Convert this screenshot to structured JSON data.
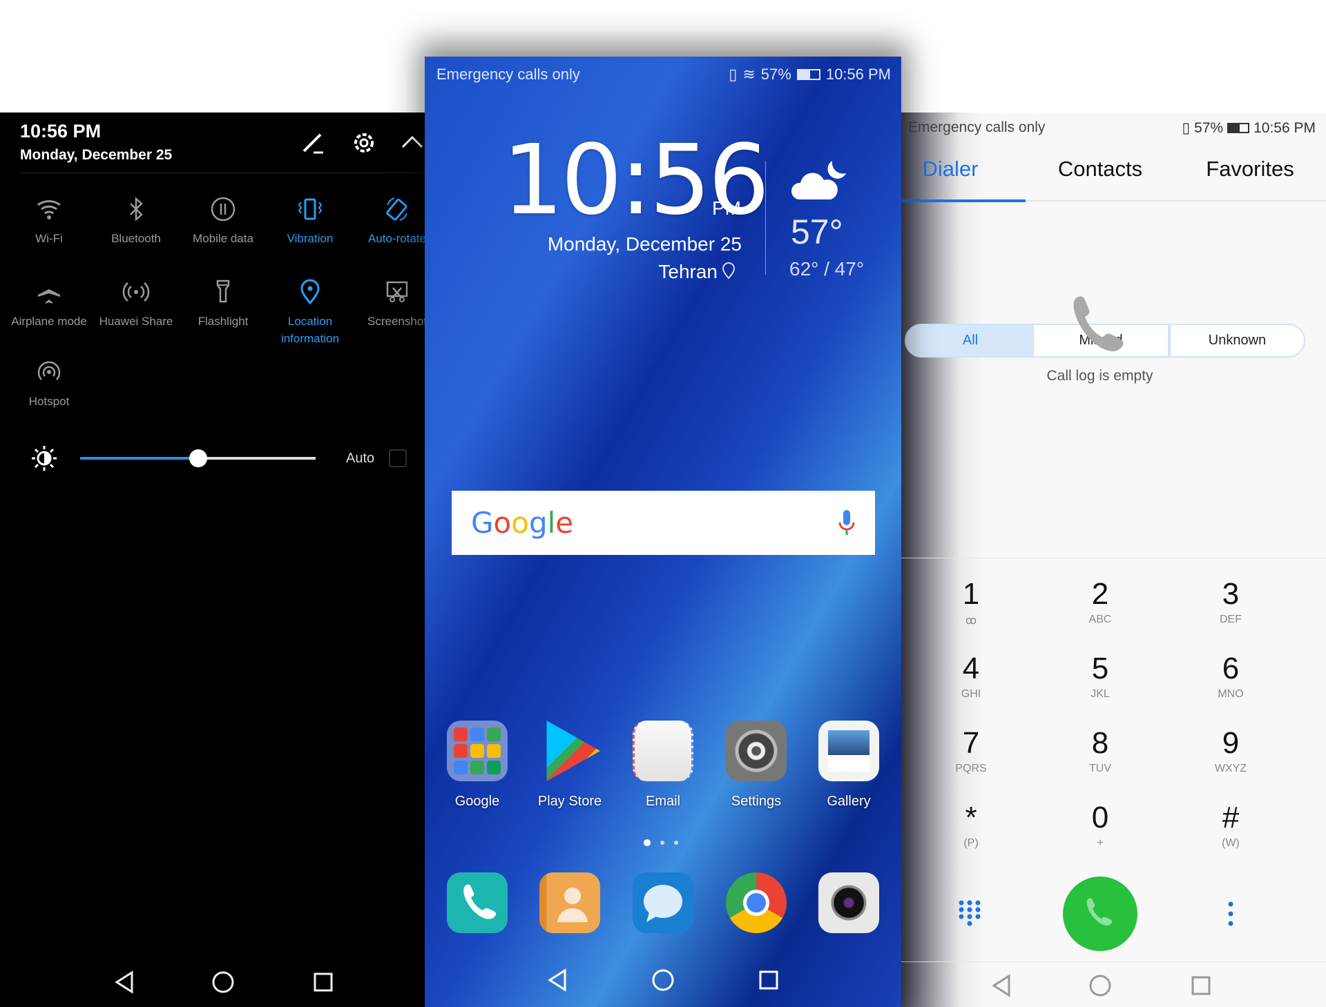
{
  "quick_settings": {
    "time": "10:56 PM",
    "date": "Monday, December 25",
    "tiles": [
      {
        "label": "Wi-Fi",
        "icon": "wifi-icon",
        "active": false
      },
      {
        "label": "Bluetooth",
        "icon": "bluetooth-icon",
        "active": false
      },
      {
        "label": "Mobile data",
        "icon": "mobile-data-icon",
        "active": false
      },
      {
        "label": "Vibration",
        "icon": "vibration-icon",
        "active": true
      },
      {
        "label": "Auto-rotate",
        "icon": "auto-rotate-icon",
        "active": true
      },
      {
        "label": "Airplane mode",
        "icon": "airplane-icon",
        "active": false
      },
      {
        "label": "Huawei Share",
        "icon": "share-icon",
        "active": false
      },
      {
        "label": "Flashlight",
        "icon": "flashlight-icon",
        "active": false
      },
      {
        "label": "Location information",
        "icon": "location-icon",
        "active": true
      },
      {
        "label": "Screenshot",
        "icon": "screenshot-icon",
        "active": false
      },
      {
        "label": "Hotspot",
        "icon": "hotspot-icon",
        "active": false
      }
    ],
    "brightness_percent": 50,
    "auto_label": "Auto",
    "auto_checked": false,
    "accent": "#2a9df4"
  },
  "home": {
    "status_left": "Emergency calls only",
    "battery": "57%",
    "status_time": "10:56 PM",
    "clock": "10:56",
    "ampm": "PM",
    "date": "Monday, December 25",
    "city": "Tehran",
    "temp": "57°",
    "range": "62° / 47°",
    "search_logo": "Google",
    "apps": [
      {
        "label": "Google"
      },
      {
        "label": "Play Store"
      },
      {
        "label": "Email"
      },
      {
        "label": "Settings"
      },
      {
        "label": "Gallery"
      }
    ],
    "dock": [
      "phone",
      "contacts",
      "messages",
      "chrome",
      "camera"
    ],
    "page": 1,
    "pages": 3
  },
  "dialer": {
    "status_left": "Emergency calls only",
    "battery": "57%",
    "status_time": "10:56 PM",
    "tabs": [
      "Dialer",
      "Contacts",
      "Favorites"
    ],
    "active_tab": "Dialer",
    "filters": [
      "All",
      "Missed",
      "Unknown"
    ],
    "active_filter": "All",
    "empty_text": "Call log is empty",
    "keys": [
      {
        "d": "1",
        "l": "ꝏ"
      },
      {
        "d": "2",
        "l": "ABC"
      },
      {
        "d": "3",
        "l": "DEF"
      },
      {
        "d": "4",
        "l": "GHI"
      },
      {
        "d": "5",
        "l": "JKL"
      },
      {
        "d": "6",
        "l": "MNO"
      },
      {
        "d": "7",
        "l": "PQRS"
      },
      {
        "d": "8",
        "l": "TUV"
      },
      {
        "d": "9",
        "l": "WXYZ"
      },
      {
        "d": "*",
        "l": "(P)"
      },
      {
        "d": "0",
        "l": "+"
      },
      {
        "d": "#",
        "l": "(W)"
      }
    ],
    "accent": "#1a73e8",
    "call_color": "#27c13d"
  }
}
